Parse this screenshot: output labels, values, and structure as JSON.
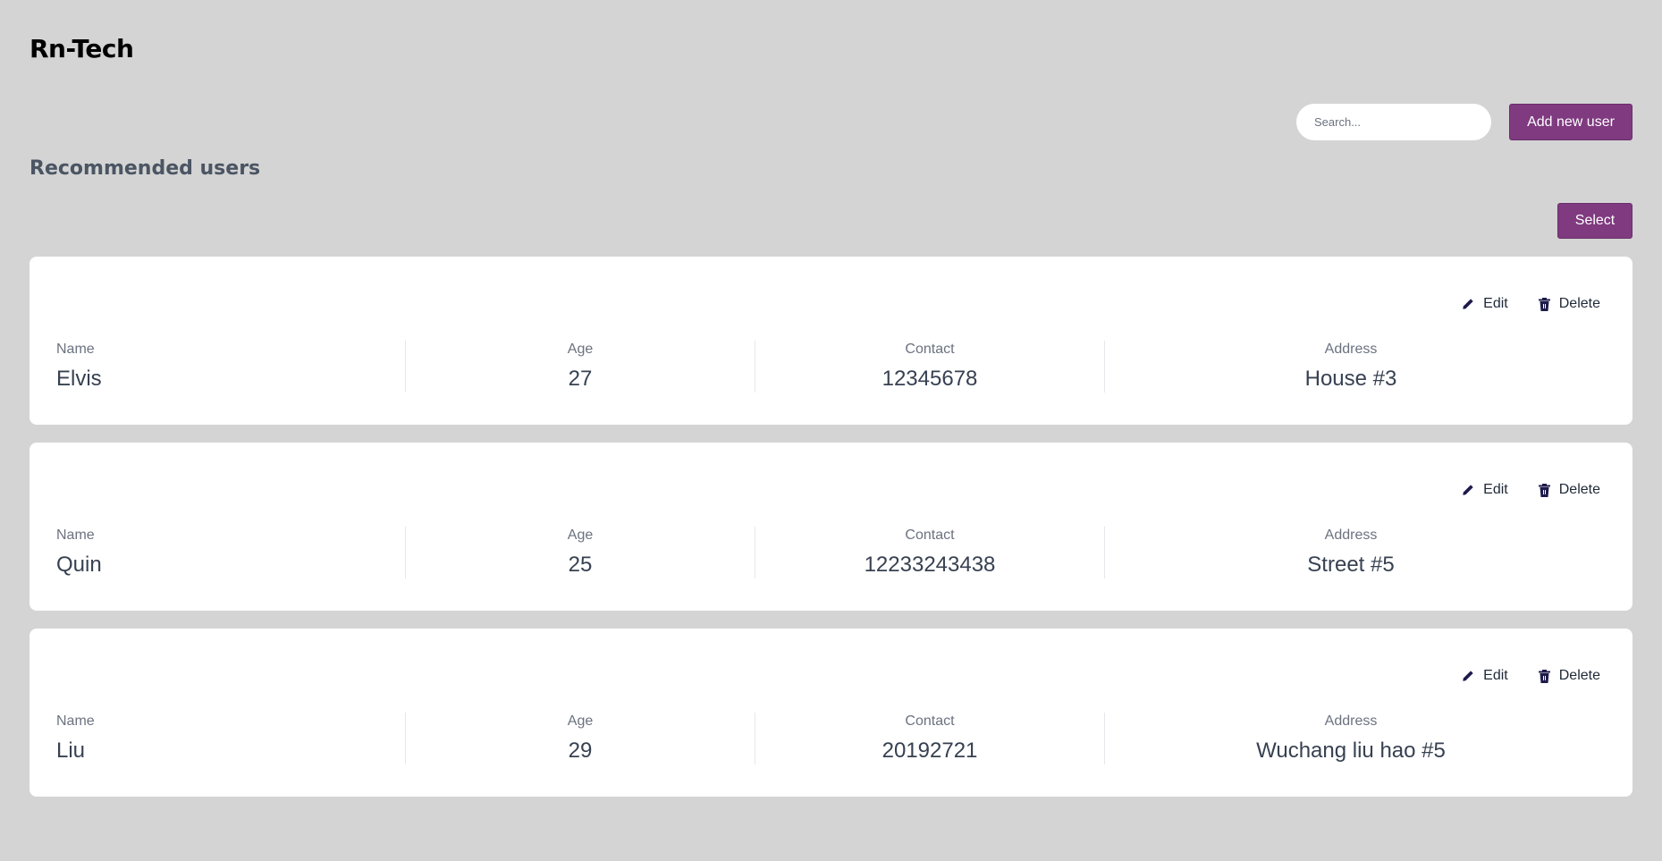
{
  "brand": "Rn-Tech",
  "toolbar": {
    "search_placeholder": "Search...",
    "add_label": "Add new user"
  },
  "section_title": "Recommended users",
  "select_label": "Select",
  "labels": {
    "name": "Name",
    "age": "Age",
    "contact": "Contact",
    "address": "Address",
    "edit": "Edit",
    "delete": "Delete"
  },
  "icons": {
    "edit": "pencil-icon",
    "delete": "trash-icon"
  },
  "colors": {
    "background": "#d4d4d4",
    "accent": "#7f3a80",
    "card": "#ffffff",
    "icon": "#1e1b4b"
  },
  "users": [
    {
      "name": "Elvis",
      "age": "27",
      "contact": "12345678",
      "address": "House #3"
    },
    {
      "name": "Quin",
      "age": "25",
      "contact": "12233243438",
      "address": "Street #5"
    },
    {
      "name": "Liu",
      "age": "29",
      "contact": "20192721",
      "address": "Wuchang liu hao #5"
    }
  ]
}
